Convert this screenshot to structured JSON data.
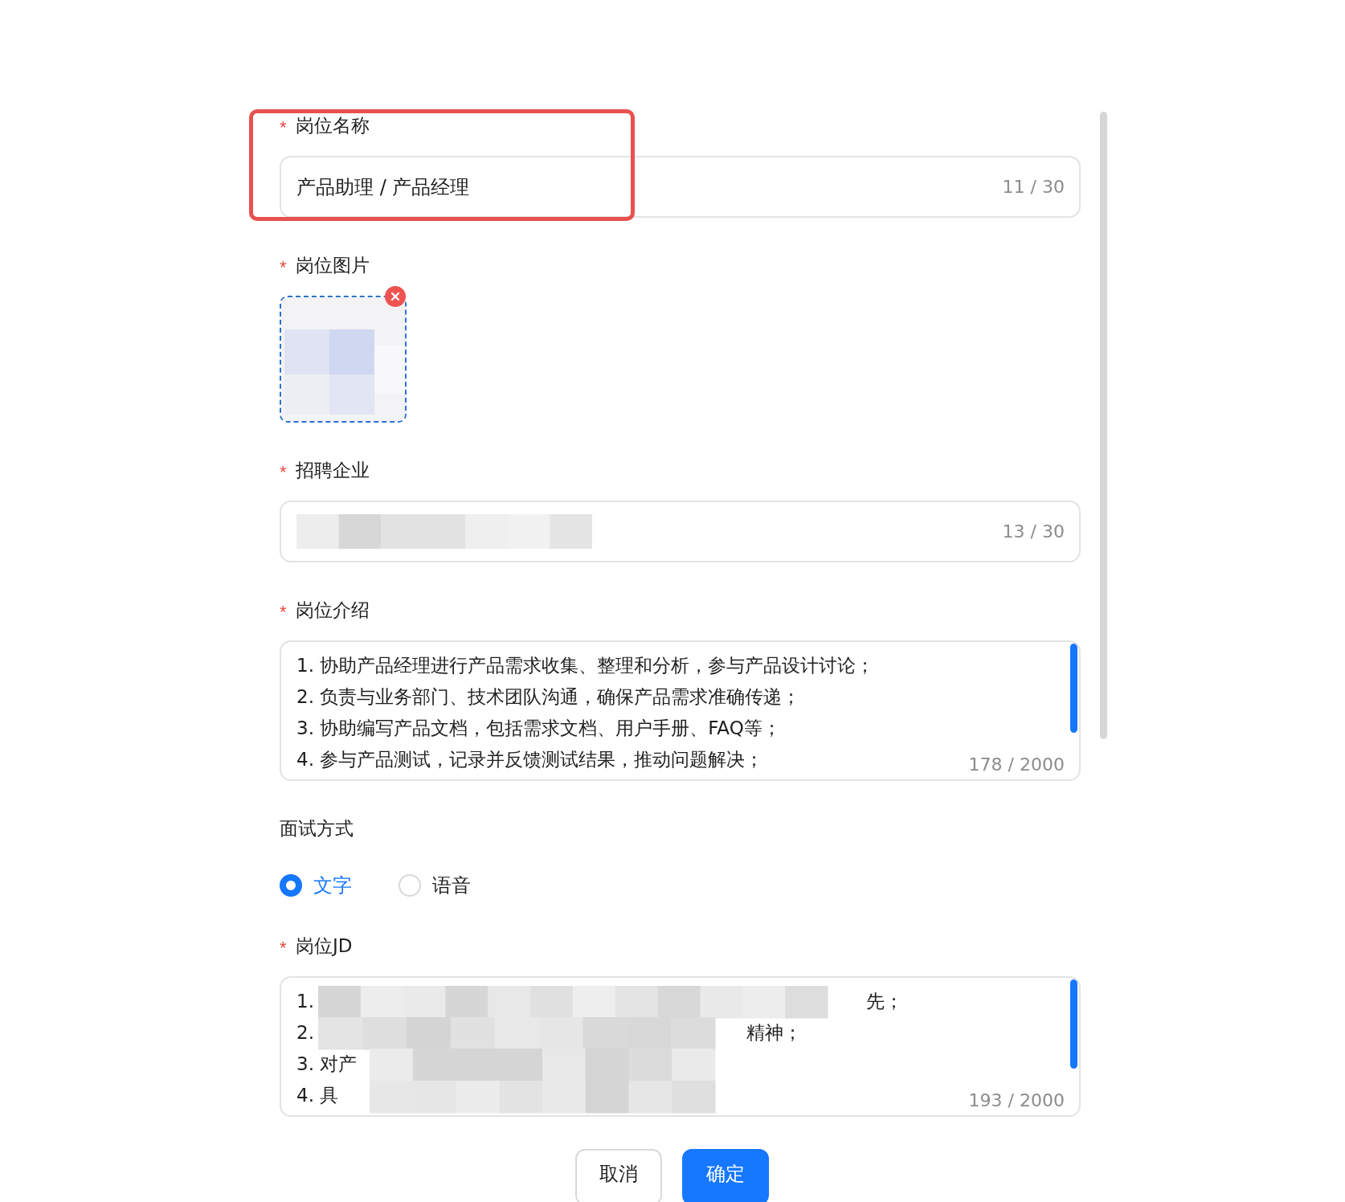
{
  "fields": [
    {
      "kind": "input",
      "label": "岗位名称",
      "required_mark": "*",
      "highlighted": true,
      "value": "产品助理 / 产品经理",
      "counter": "11 / 30"
    },
    {
      "label": "岗位图片",
      "required_mark": "*",
      "removable": true
    },
    {
      "kind": "input",
      "label": "招聘企业",
      "required_mark": "*",
      "redacted": true,
      "counter": "13 / 30"
    },
    {
      "kind": "textarea",
      "label": "岗位介绍",
      "required_mark": "*",
      "lines": [
        {
          "start": "1. 协助产品经理进行产品需求收集、整理和分析，参与产品设计讨论；"
        },
        {
          "start": "2. 负责与业务部门、技术团队沟通，确保产品需求准确传递；"
        },
        {
          "start": "3. 协助编写产品文档，包括需求文档、用户手册、FAQ等；"
        },
        {
          "start": "4. 参与产品测试，记录并反馈测试结果，推动问题解决；"
        }
      ],
      "counter": "178 / 2000"
    },
    {
      "kind": "radio",
      "label": "面试方式",
      "options": [
        {
          "label": "文字",
          "selected": true
        },
        {
          "label": "语音",
          "selected": false
        }
      ]
    },
    {
      "kind": "textarea",
      "label": "岗位JD",
      "required_mark": "*",
      "redacted": true,
      "lines": [
        {
          "start": "1.",
          "end": "先；"
        },
        {
          "start": "2.",
          "end": "精神；"
        },
        {
          "start": "3. 对产"
        },
        {
          "start": "4. 具"
        }
      ],
      "counter": "193 / 2000"
    }
  ],
  "buttons": [
    {
      "label": "取消",
      "kind": "secondary"
    },
    {
      "label": "确定",
      "kind": "primary"
    }
  ]
}
